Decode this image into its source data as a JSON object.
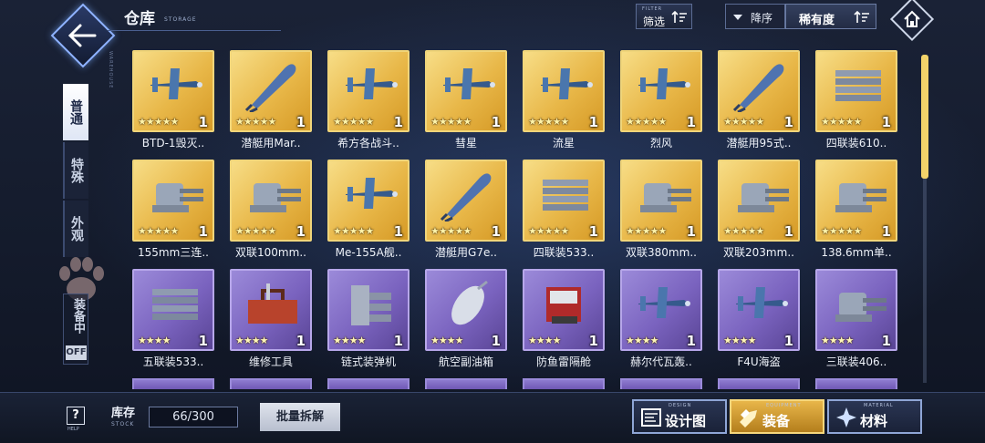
{
  "header": {
    "title": "仓库",
    "title_sub": "STORAGE",
    "filter": {
      "small": "FILTER",
      "label": "筛选"
    },
    "order_label": "降序",
    "rarity_label": "稀有度"
  },
  "side": {
    "deco_text": "WAREHOUSE",
    "tabs": [
      {
        "label": "普通",
        "active": true
      },
      {
        "label": "特殊",
        "active": false
      },
      {
        "label": "外观",
        "active": false
      }
    ],
    "equip_text": "装备中",
    "equip_state": "OFF"
  },
  "items": [
    {
      "name": "BTD-1毁灭..",
      "stars": "★★★★★",
      "count": "1",
      "rarity": "gold",
      "icon": "plane-icon"
    },
    {
      "name": "潜艇用Mar..",
      "stars": "★★★★★",
      "count": "1",
      "rarity": "gold",
      "icon": "torpedo-icon"
    },
    {
      "name": "希方各战斗..",
      "stars": "★★★★★",
      "count": "1",
      "rarity": "gold",
      "icon": "plane-icon"
    },
    {
      "name": "彗星",
      "stars": "★★★★★",
      "count": "1",
      "rarity": "gold",
      "icon": "plane-icon"
    },
    {
      "name": "流星",
      "stars": "★★★★★",
      "count": "1",
      "rarity": "gold",
      "icon": "plane-icon"
    },
    {
      "name": "烈风",
      "stars": "★★★★★",
      "count": "1",
      "rarity": "gold",
      "icon": "plane-icon"
    },
    {
      "name": "潜艇用95式..",
      "stars": "★★★★★",
      "count": "1",
      "rarity": "gold",
      "icon": "torpedo-icon"
    },
    {
      "name": "四联装610..",
      "stars": "★★★★★",
      "count": "1",
      "rarity": "gold",
      "icon": "launcher-icon"
    },
    {
      "name": "155mm三连..",
      "stars": "★★★★★",
      "count": "1",
      "rarity": "gold",
      "icon": "turret-icon"
    },
    {
      "name": "双联100mm..",
      "stars": "★★★★★",
      "count": "1",
      "rarity": "gold",
      "icon": "turret-icon"
    },
    {
      "name": "Me-155A舰..",
      "stars": "★★★★★",
      "count": "1",
      "rarity": "gold",
      "icon": "plane-icon"
    },
    {
      "name": "潜艇用G7e..",
      "stars": "★★★★★",
      "count": "1",
      "rarity": "gold",
      "icon": "torpedo-icon"
    },
    {
      "name": "四联装533..",
      "stars": "★★★★★",
      "count": "1",
      "rarity": "gold",
      "icon": "launcher-icon"
    },
    {
      "name": "双联380mm..",
      "stars": "★★★★★",
      "count": "1",
      "rarity": "gold",
      "icon": "turret-icon"
    },
    {
      "name": "双联203mm..",
      "stars": "★★★★★",
      "count": "1",
      "rarity": "gold",
      "icon": "turret-icon"
    },
    {
      "name": "138.6mm单..",
      "stars": "★★★★★",
      "count": "1",
      "rarity": "gold",
      "icon": "turret-icon"
    },
    {
      "name": "五联装533..",
      "stars": "★★★★",
      "count": "1",
      "rarity": "purple",
      "icon": "launcher-icon"
    },
    {
      "name": "维修工具",
      "stars": "★★★★",
      "count": "1",
      "rarity": "purple",
      "icon": "toolbox-icon"
    },
    {
      "name": "链式装弹机",
      "stars": "★★★★",
      "count": "1",
      "rarity": "purple",
      "icon": "loader-icon"
    },
    {
      "name": "航空副油箱",
      "stars": "★★★★",
      "count": "1",
      "rarity": "purple",
      "icon": "fuel-tank-icon"
    },
    {
      "name": "防鱼雷隔舱",
      "stars": "★★★★",
      "count": "1",
      "rarity": "purple",
      "icon": "bulkhead-icon"
    },
    {
      "name": "赫尔代瓦轰..",
      "stars": "★★★★",
      "count": "1",
      "rarity": "purple",
      "icon": "plane-icon"
    },
    {
      "name": "F4U海盗",
      "stars": "★★★★",
      "count": "1",
      "rarity": "purple",
      "icon": "plane-icon"
    },
    {
      "name": "三联装406..",
      "stars": "★★★★",
      "count": "1",
      "rarity": "purple",
      "icon": "turret-icon"
    }
  ],
  "footer": {
    "help_label": "HELP",
    "stock_label": "库存",
    "stock_sub": "STOCK",
    "stock_value": "66/300",
    "bulk_label": "批量拆解",
    "nav": [
      {
        "small": "DESIGN",
        "label": "设计图",
        "active": false,
        "icon": "blueprint-icon"
      },
      {
        "small": "EQUIPMENT",
        "label": "装备",
        "active": true,
        "icon": "equipment-icon"
      },
      {
        "small": "MATERIAL",
        "label": "材料",
        "active": false,
        "icon": "material-icon"
      }
    ]
  },
  "colors": {
    "gold": "#e8b748",
    "purple": "#7a63bf",
    "accent": "#f3d36a"
  }
}
